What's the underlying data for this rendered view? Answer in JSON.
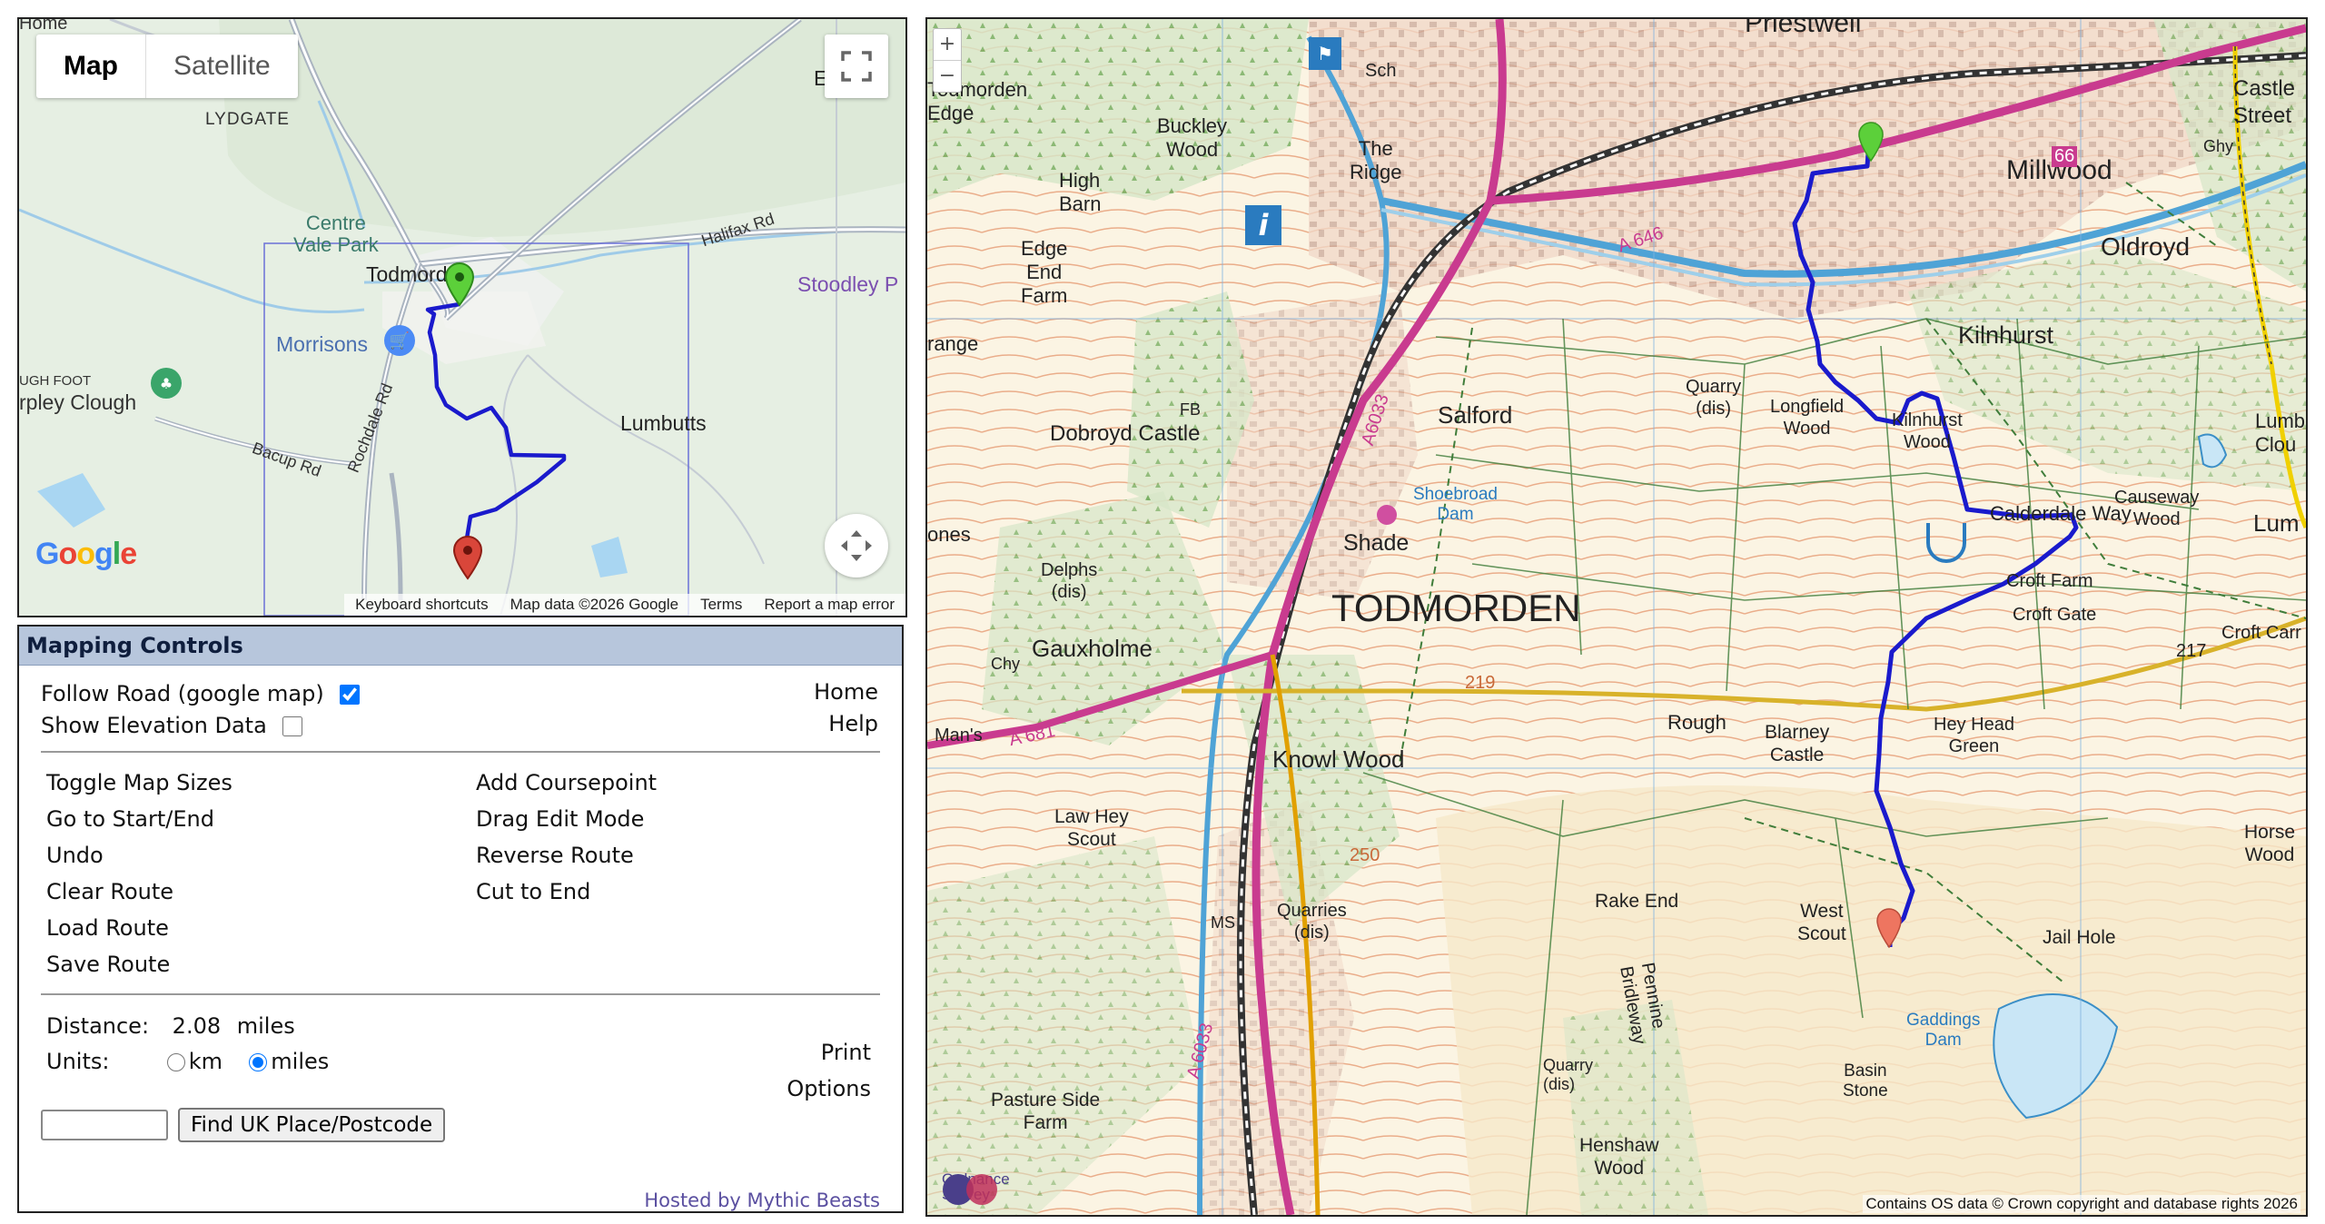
{
  "google_map": {
    "map_types": [
      "Map",
      "Satellite"
    ],
    "active_map_type": "Map",
    "footer": [
      "Keyboard shortcuts",
      "Map data ©2026 Google",
      "Terms",
      "Report a map error"
    ],
    "logo": "Google",
    "places": {
      "lydgate": "LYDGATE",
      "centre_vale": "Centre\nVale Park",
      "todmorden": "Todmorden",
      "morrisons": "Morrisons",
      "lumbutts": "Lumbutts",
      "stoodley": "Stoodley P",
      "bacup_rd": "Bacup Rd",
      "rochdale_rd": "Rochdale Rd",
      "halifax_rd": "Halifax Rd",
      "clough": "rpley Clough",
      "foot": "UGH FOOT",
      "edge_label": "E",
      "home_label": "Home"
    },
    "colors": {
      "route": "#1a1acc",
      "start_pin": "#5cd03a",
      "end_pin": "#d9463a"
    }
  },
  "controls": {
    "title": "Mapping Controls",
    "follow_road": {
      "label": "Follow Road (google map)",
      "checked": true
    },
    "show_elevation": {
      "label": "Show Elevation Data",
      "checked": false
    },
    "home": "Home",
    "help": "Help",
    "left_menu": [
      "Toggle Map Sizes",
      "Go to Start/End",
      "Undo",
      "Clear Route",
      "Load Route",
      "Save Route"
    ],
    "right_menu": [
      "Add Coursepoint",
      "Drag Edit Mode",
      "Reverse Route",
      "Cut to End"
    ],
    "distance_label": "Distance:",
    "distance_value": "2.08",
    "distance_unit": "miles",
    "units_label": "Units:",
    "unit_km": "km",
    "unit_miles": "miles",
    "selected_unit": "miles",
    "print": "Print",
    "options": "Options",
    "postcode_value": "",
    "find_button": "Find UK Place/Postcode",
    "hosted_by": "Hosted by Mythic Beasts"
  },
  "os_map": {
    "zoom_in": "+",
    "zoom_out": "−",
    "copyright": "Contains OS data © Crown copyright and database rights 2026",
    "logo_text": [
      "Ordnance",
      "Survey"
    ],
    "labels": {
      "priestwell": "Priestwell",
      "todmorden_edge": "Todmorden\nEdge",
      "buckley": "Buckley\nWood",
      "the_ridge": "The\nRidge",
      "high_barn": "High\nBarn",
      "millwood": "Millwood",
      "castle_street": "Castle\nStreet",
      "oldroyd": "Oldroyd",
      "edge_end": "Edge\nEnd\nFarm",
      "kilnhurst": "Kilnhurst",
      "quarry": "Quarry\n(dis)",
      "longfield": "Longfield\nWood",
      "kilnhurst_wood": "Kilnhurst\nWood",
      "dobroyd": "Dobroyd Castle",
      "salford": "Salford",
      "shoebroad": "Shoebroad\nDam",
      "calderdale": "Calderdale Way",
      "causeway": "Causeway\nWood",
      "shade": "Shade",
      "delphs": "Delphs\n(dis)",
      "todmorden": "TODMORDEN",
      "croft_farm": "Croft Farm",
      "croft_gate": "Croft Gate",
      "croft_carr": "Croft Carr",
      "gauxholme": "Gauxholme",
      "rough": "Rough",
      "blarney": "Blarney\nCastle",
      "hey_head": "Hey Head\nGreen",
      "knowl_wood": "Knowl Wood",
      "law_hey": "Law Hey\nScout",
      "quarries": "Quarries\n(dis)",
      "rake_end": "Rake End",
      "west_scout": "West\nScout",
      "jail_hole": "Jail Hole",
      "horse_wood": "Horse\nWood",
      "pennine": "Pennine\nBridleway",
      "gaddings": "Gaddings\nDam",
      "basin_stone": "Basin\nStone",
      "pasture_side": "Pasture Side\nFarm",
      "henshaw": "Henshaw\nWood",
      "quarry2": "Quarry\n(dis)",
      "a646": "A 646",
      "a6033": "A6033",
      "a6033b": "A 6033",
      "a681": "A 681",
      "b6138": "66",
      "range": "range",
      "ones": "ones",
      "man_s": "Man's",
      "lum": "Lum",
      "lumb_clou": "Lumb\nClou",
      "ghy": "Ghy",
      "sch": "Sch",
      "fb": "FB",
      "ms": "MS",
      "chy": "Chy",
      "h217": "217",
      "h219": "219",
      "h250": "250"
    },
    "colors": {
      "route": "#1a1acc",
      "start_pin": "#5cd03a",
      "end_pin": "#ee7560"
    }
  }
}
